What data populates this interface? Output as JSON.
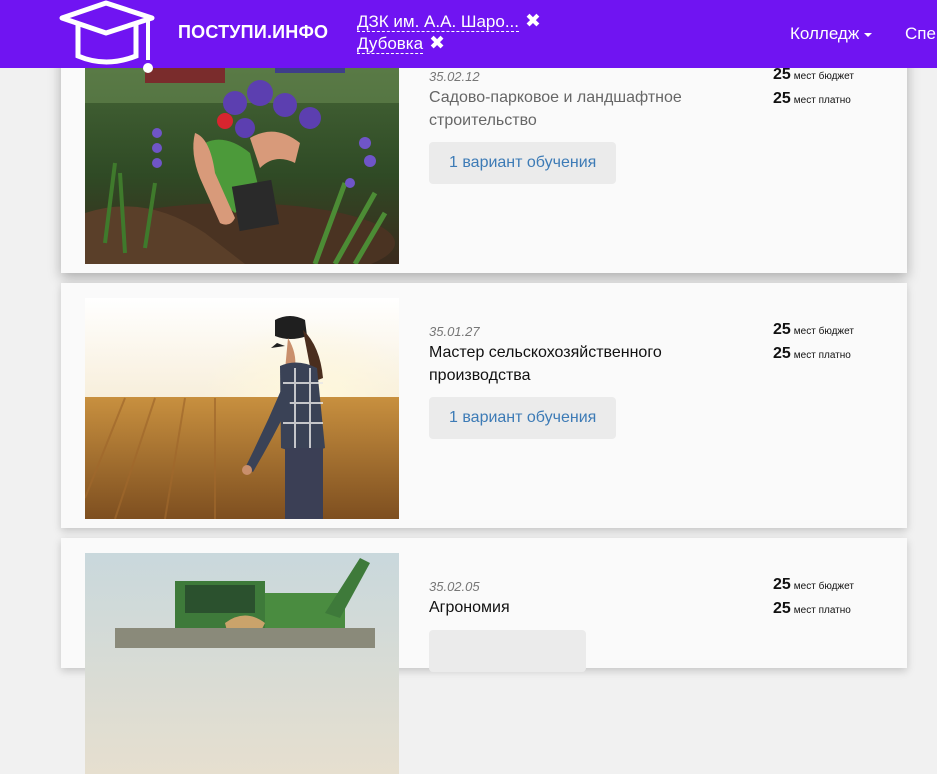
{
  "header": {
    "brand": "ПОСТУПИ.ИНФО",
    "filters": [
      {
        "label": "ДЗК им. А.А. Шаро...",
        "remove_icon": "close-icon"
      },
      {
        "label": "Дубовка",
        "remove_icon": "close-icon"
      }
    ],
    "nav": {
      "college": "Колледж",
      "specialties": "Спе"
    },
    "bg_color": "#7014f2"
  },
  "programs": [
    {
      "code": "35.02.12",
      "title": "Садово-парковое и ландшафтное строительство",
      "variants_button": "1 вариант обучения",
      "budget_count": "25",
      "budget_label": "мест бюджет",
      "paid_count": "25",
      "paid_label": "мест платно"
    },
    {
      "code": "35.01.27",
      "title": "Мастер сельскохозяйственного производства",
      "variants_button": "1 вариант обучения",
      "budget_count": "25",
      "budget_label": "мест бюджет",
      "paid_count": "25",
      "paid_label": "мест платно"
    },
    {
      "code": "35.02.05",
      "title": "Агрономия",
      "variants_button": "",
      "budget_count": "25",
      "budget_label": "мест бюджет",
      "paid_count": "25",
      "paid_label": "мест платно"
    }
  ],
  "colors": {
    "link": "#3d7bb6",
    "button_bg": "#ebebeb"
  }
}
